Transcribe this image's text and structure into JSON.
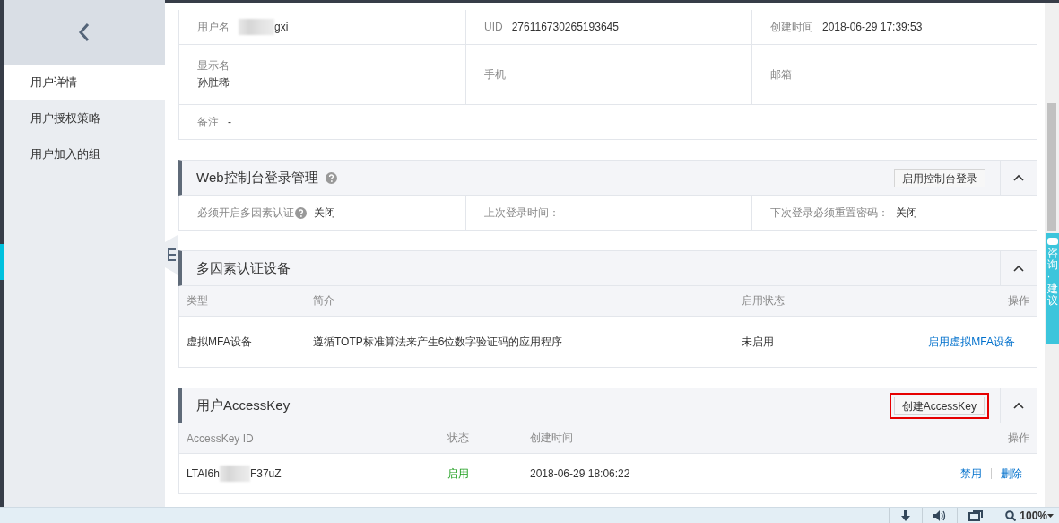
{
  "sidebar": {
    "items": [
      {
        "label": "用户详情",
        "selected": true
      },
      {
        "label": "用户授权策略",
        "selected": false
      },
      {
        "label": "用户加入的组",
        "selected": false
      }
    ]
  },
  "user_info": {
    "rows": [
      [
        {
          "label": "用户名",
          "value": "gxi",
          "redacted": true
        },
        {
          "label": "UID",
          "value": "276116730265193645"
        },
        {
          "label": "创建时间",
          "value": "2018-06-29 17:39:53"
        }
      ],
      [
        {
          "label": "显示名",
          "value": "孙胜稀",
          "stacked": true
        },
        {
          "label": "手机"
        },
        {
          "label": "邮箱"
        }
      ],
      [
        {
          "label": "备注",
          "value": "-"
        }
      ]
    ]
  },
  "console_login": {
    "title": "Web控制台登录管理",
    "help": true,
    "button": "启用控制台登录",
    "expanded": true,
    "fields": [
      {
        "label": "必须开启多因素认证",
        "help": true,
        "value": "关闭"
      },
      {
        "label": "上次登录时间："
      },
      {
        "label": "下次登录必须重置密码：",
        "value": "关闭"
      }
    ]
  },
  "mfa": {
    "title": "多因素认证设备",
    "expanded": true,
    "columns": [
      "类型",
      "简介",
      "启用状态",
      "操作"
    ],
    "rows": [
      {
        "cells": [
          "虚拟MFA设备",
          "遵循TOTP标准算法来产生6位数字验证码的应用程序",
          "未启用"
        ],
        "actions": [
          "启用虚拟MFA设备"
        ]
      }
    ]
  },
  "access_key": {
    "title": "用户AccessKey",
    "button": "创建AccessKey",
    "highlighted": true,
    "expanded": true,
    "columns": [
      "AccessKey ID",
      "状态",
      "创建时间",
      "操作"
    ],
    "rows": [
      {
        "id_start": "LTAI6h",
        "id_end": "F37uZ",
        "redacted": true,
        "status": "启用",
        "status_on": true,
        "created": "2018-06-29 18:06:22",
        "actions": [
          "禁用",
          "删除"
        ]
      }
    ]
  },
  "consult_tab": "咨询·建议",
  "status_bar": {
    "zoom": "100%"
  }
}
